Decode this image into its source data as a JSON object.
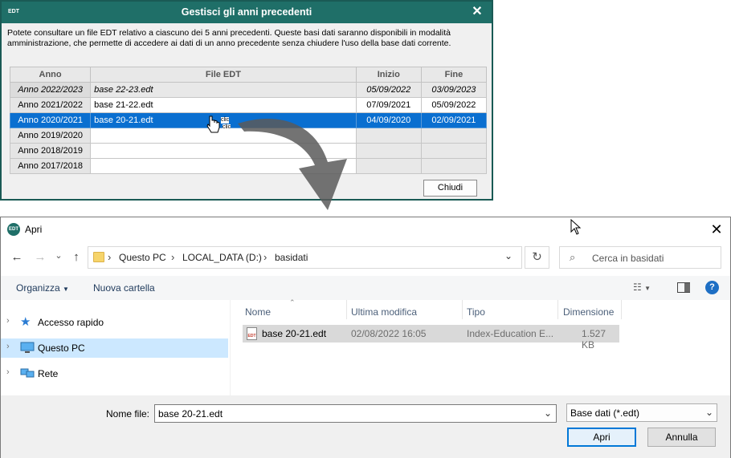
{
  "prev_years_dialog": {
    "logo": "EDT",
    "title": "Gestisci gli anni precedenti",
    "close_glyph": "✕",
    "description": "Potete consultare un file EDT relativo a ciascuno dei 5 anni precedenti. Queste basi dati saranno disponibili in modalità amministrazione, che permette di accedere ai dati di un anno precedente senza chiudere l'uso della base dati corrente.",
    "columns": [
      "Anno",
      "File EDT",
      "Inizio",
      "Fine"
    ],
    "rows": [
      {
        "anno": "Anno 2022/2023",
        "file": "base  22-23.edt",
        "inizio": "05/09/2022",
        "fine": "03/09/2023"
      },
      {
        "anno": "Anno 2021/2022",
        "file": "base  21-22.edt",
        "inizio": "07/09/2021",
        "fine": "05/09/2022"
      },
      {
        "anno": "Anno 2020/2021",
        "file": "base  20-21.edt",
        "inizio": "04/09/2020",
        "fine": "02/09/2021"
      },
      {
        "anno": "Anno 2019/2020",
        "file": "",
        "inizio": "",
        "fine": ""
      },
      {
        "anno": "Anno 2018/2019",
        "file": "",
        "inizio": "",
        "fine": ""
      },
      {
        "anno": "Anno 2017/2018",
        "file": "",
        "inizio": "",
        "fine": ""
      }
    ],
    "click_label_1": "clic",
    "click_label_2": "clic",
    "close_button": "Chiudi"
  },
  "open_dialog": {
    "logo": "EDT",
    "title": "Apri",
    "close_glyph": "✕",
    "nav": {
      "back": "←",
      "forward": "→",
      "recent": "⌄",
      "up": "↑"
    },
    "address": [
      "Questo PC",
      "LOCAL_DATA (D:)",
      "basidati"
    ],
    "address_sep": "›",
    "refresh": "↻",
    "search_icon": "search-icon",
    "search_placeholder": "Cerca in basidati",
    "organize": "Organizza",
    "new_folder": "Nuova cartella",
    "help_glyph": "?",
    "nav_items": [
      {
        "label": "Accesso rapido",
        "icon": "star-icon"
      },
      {
        "label": "Questo PC",
        "icon": "computer-icon"
      },
      {
        "label": "Rete",
        "icon": "network-icon"
      }
    ],
    "columns": [
      "Nome",
      "Ultima modifica",
      "Tipo",
      "Dimensione"
    ],
    "files": [
      {
        "name": "base 20-21.edt",
        "modified": "02/08/2022 16:05",
        "type": "Index-Education E...",
        "size": "1.527 KB",
        "icon_text": "EDT"
      }
    ],
    "filename_label": "Nome file:",
    "filename_value": "base 20-21.edt",
    "filetype_value": "Base dati (*.edt)",
    "open_button": "Apri",
    "cancel_button": "Annulla"
  },
  "colors": {
    "title_bar": "#1f6f68",
    "selection": "#0a6fd0",
    "accent": "#0078d7"
  }
}
